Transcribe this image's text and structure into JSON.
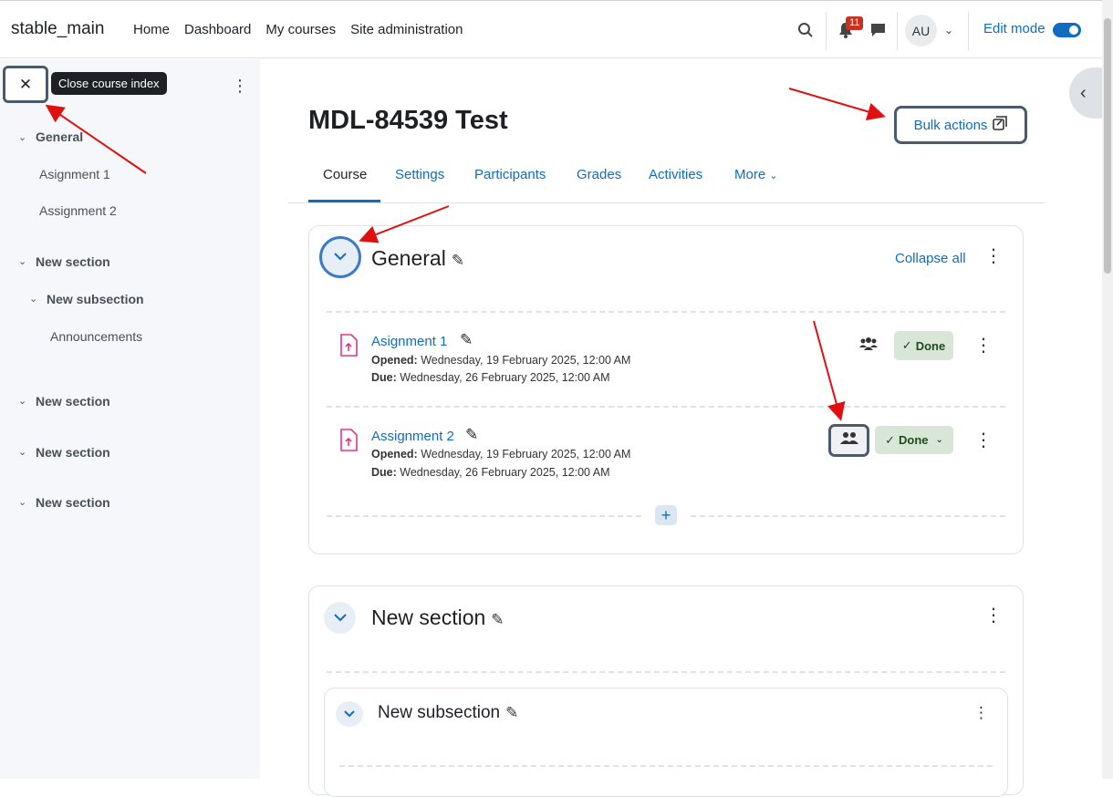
{
  "header": {
    "site_name": "stable_main",
    "nav": [
      "Home",
      "Dashboard",
      "My courses",
      "Site administration"
    ],
    "notification_count": "11",
    "avatar_initials": "AU",
    "edit_mode_label": "Edit mode"
  },
  "sidebar": {
    "close_tooltip": "Close course index",
    "sections": [
      {
        "label": "General",
        "items": [
          "Asignment 1",
          "Assignment 2"
        ]
      },
      {
        "label": "New section",
        "subsection": "New subsection",
        "sub_items": [
          "Announcements"
        ]
      },
      {
        "label": "New section"
      },
      {
        "label": "New section"
      },
      {
        "label": "New section"
      }
    ]
  },
  "course": {
    "title": "MDL-84539 Test",
    "bulk_label": "Bulk actions",
    "tabs": [
      "Course",
      "Settings",
      "Participants",
      "Grades",
      "Activities",
      "More"
    ]
  },
  "general": {
    "title": "General",
    "collapse_all": "Collapse all",
    "activities": [
      {
        "name": "Asignment 1",
        "opened_label": "Opened:",
        "opened": "Wednesday, 19 February 2025, 12:00 AM",
        "due_label": "Due:",
        "due": "Wednesday, 26 February 2025, 12:00 AM",
        "done": "Done"
      },
      {
        "name": "Assignment 2",
        "opened_label": "Opened:",
        "opened": "Wednesday, 19 February 2025, 12:00 AM",
        "due_label": "Due:",
        "due": "Wednesday, 26 February 2025, 12:00 AM",
        "done": "Done"
      }
    ]
  },
  "section2": {
    "title": "New section",
    "subsection_title": "New subsection"
  },
  "colors": {
    "primary": "#0f6cbf",
    "annotation": "#e01010",
    "done_bg": "#d7e6d7"
  }
}
